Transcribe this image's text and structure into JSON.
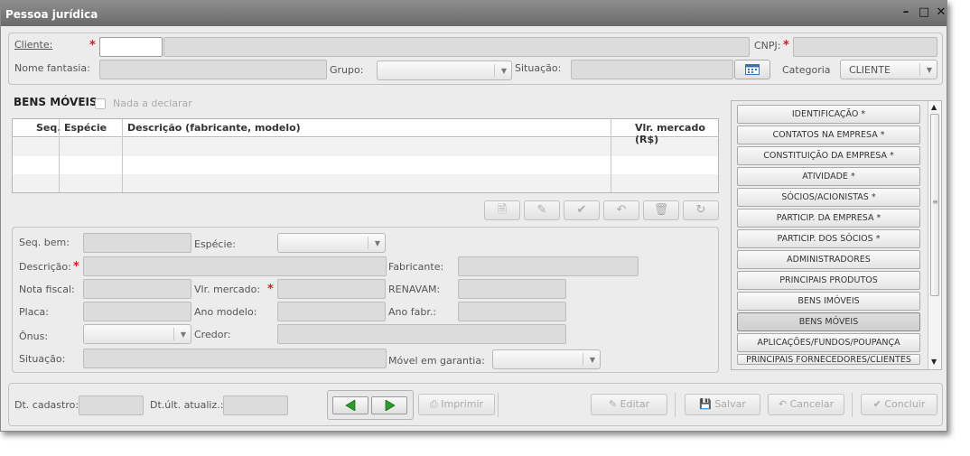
{
  "window": {
    "title": "Pessoa jurídica"
  },
  "header": {
    "cliente_label": "Cliente:",
    "cnpj_label": "CNPJ:",
    "nome_fantasia_label": "Nome fantasia:",
    "grupo_label": "Grupo:",
    "situacao_label": "Situação:",
    "categoria_label": "Categoria",
    "categoria_value": "CLIENTE"
  },
  "bens": {
    "title": "BENS MÓVEIS",
    "nada_label": "Nada a declarar",
    "columns": [
      "Seq.",
      "Espécie",
      "Descrição (fabricante, modelo)",
      "Vlr. mercado (R$)"
    ]
  },
  "form": {
    "seq_bem": "Seq. bem:",
    "especie": "Espécie:",
    "descricao": "Descrição:",
    "fabricante": "Fabricante:",
    "nota_fiscal": "Nota fiscal:",
    "vlr_mercado": "Vlr. mercado:",
    "renavam": "RENAVAM:",
    "placa": "Placa:",
    "ano_modelo": "Ano modelo:",
    "ano_fabr": "Ano fabr.:",
    "onus": "Ônus:",
    "credor": "Credor:",
    "situacao": "Situação:",
    "movel_garantia": "Móvel em garantia:"
  },
  "sidebar": {
    "items": [
      "IDENTIFICAÇÃO *",
      "CONTATOS NA EMPRESA *",
      "CONSTITUIÇÃO DA EMPRESA *",
      "ATIVIDADE *",
      "SÓCIOS/ACIONISTAS *",
      "PARTICIP. DA EMPRESA *",
      "PARTICIP. DOS SÓCIOS *",
      "ADMINISTRADORES",
      "PRINCIPAIS PRODUTOS",
      "BENS IMÓVEIS",
      "BENS MÓVEIS",
      "APLICAÇÕES/FUNDOS/POUPANÇA",
      "PRINCIPAIS FORNECEDORES/CLIENTES"
    ],
    "active_index": 10
  },
  "footer": {
    "dt_cadastro": "Dt. cadastro:",
    "dt_ult": "Dt.últ. atualiz.:",
    "imprimir": "Imprimir",
    "editar": "Editar",
    "salvar": "Salvar",
    "cancelar": "Cancelar",
    "concluir": "Concluir"
  },
  "colors": {
    "nav_green": "#2f9a2f",
    "required": "#d02020",
    "titlebar": "#7a7a7a"
  }
}
